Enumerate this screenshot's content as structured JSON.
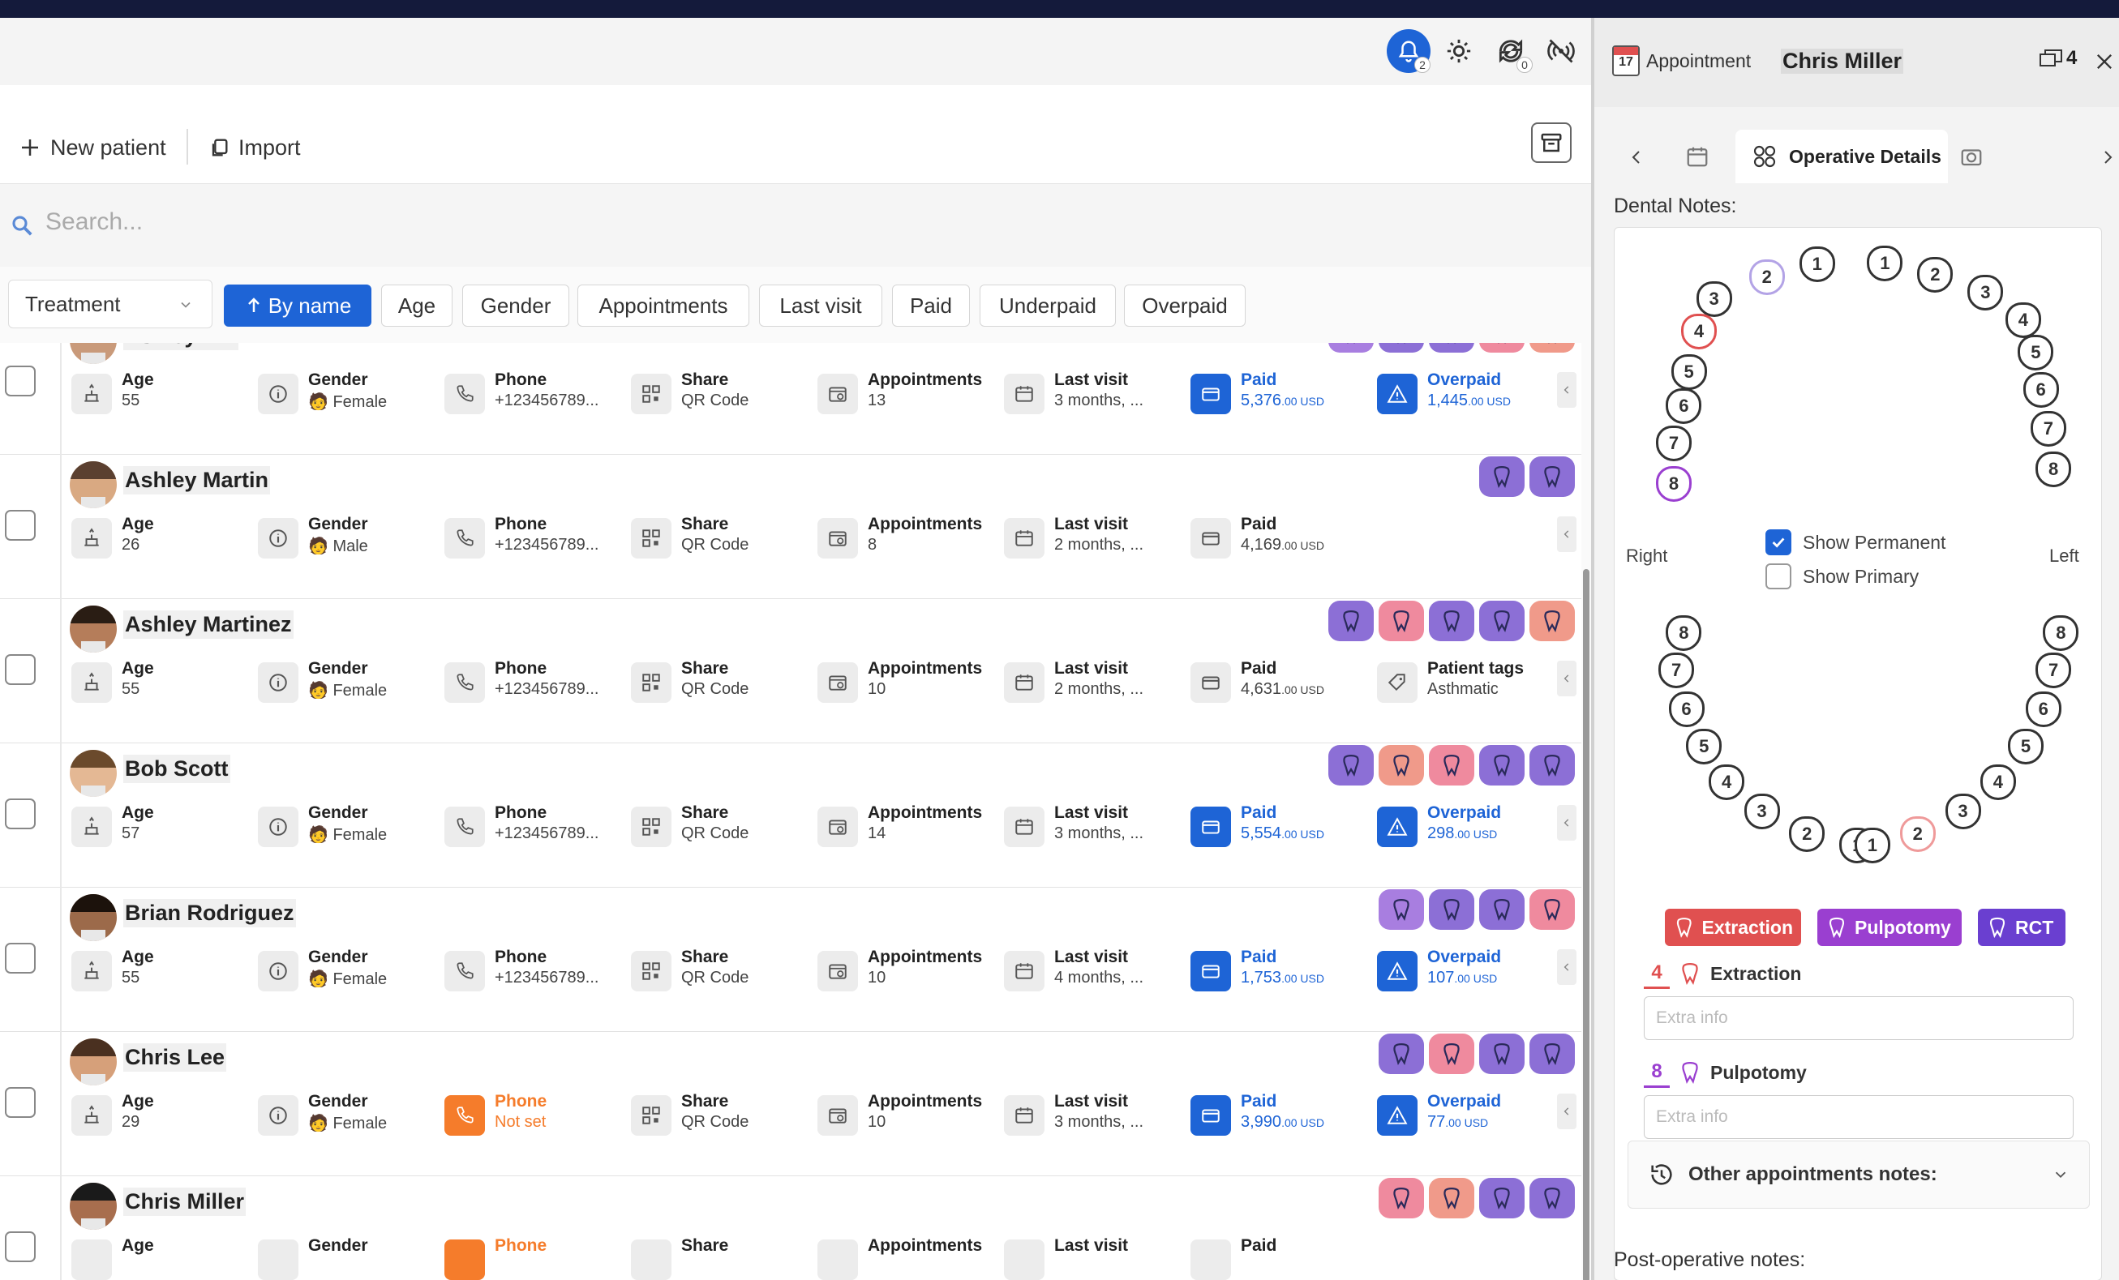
{
  "topbar": {
    "notifications_badge": "2",
    "sync_badge": "0"
  },
  "toolbar": {
    "new_patient": "New patient",
    "import": "Import"
  },
  "search": {
    "placeholder": "Search..."
  },
  "filters": {
    "select_value": "Treatment",
    "chips": [
      "By name",
      "Age",
      "Gender",
      "Appointments",
      "Last visit",
      "Paid",
      "Underpaid",
      "Overpaid"
    ],
    "active_chip": "By name"
  },
  "patients": [
    {
      "name": "Ashley Hill",
      "age": "55",
      "gender": "Female",
      "phone": "+123456789...",
      "share": "QR Code",
      "appointments": "13",
      "last_visit": "3 months, ...",
      "paid_main": "5,376",
      "paid_small": ".00 USD",
      "extra_label": "Overpaid",
      "extra_main": "1,445",
      "extra_small": ".00 USD",
      "tags": [
        "purple",
        "violet",
        "violet",
        "pink",
        "salmon"
      ]
    },
    {
      "name": "Ashley Martin",
      "age": "26",
      "gender": "Male",
      "phone": "+123456789...",
      "share": "QR Code",
      "appointments": "8",
      "last_visit": "2 months, ...",
      "paid_main": "4,169",
      "paid_small": ".00 USD",
      "extra_label": "",
      "extra_main": "",
      "extra_small": "",
      "tags": [
        "violet",
        "violet"
      ]
    },
    {
      "name": "Ashley Martinez",
      "age": "55",
      "gender": "Female",
      "phone": "+123456789...",
      "share": "QR Code",
      "appointments": "10",
      "last_visit": "2 months, ...",
      "paid_main": "4,631",
      "paid_small": ".00 USD",
      "extra_label": "Patient tags",
      "extra_main": "Asthmatic",
      "extra_small": "",
      "tags": [
        "violet",
        "pink",
        "violet",
        "violet",
        "salmon"
      ]
    },
    {
      "name": "Bob Scott",
      "age": "57",
      "gender": "Female",
      "phone": "+123456789...",
      "share": "QR Code",
      "appointments": "14",
      "last_visit": "3 months, ...",
      "paid_main": "5,554",
      "paid_small": ".00 USD",
      "extra_label": "Overpaid",
      "extra_main": "298",
      "extra_small": ".00 USD",
      "tags": [
        "violet",
        "salmon",
        "pink",
        "violet",
        "violet"
      ]
    },
    {
      "name": "Brian Rodriguez",
      "age": "55",
      "gender": "Female",
      "phone": "+123456789...",
      "share": "QR Code",
      "appointments": "10",
      "last_visit": "4 months, ...",
      "paid_main": "1,753",
      "paid_small": ".00 USD",
      "extra_label": "Overpaid",
      "extra_main": "107",
      "extra_small": ".00 USD",
      "tags": [
        "purple",
        "violet",
        "violet",
        "pink"
      ]
    },
    {
      "name": "Chris Lee",
      "age": "29",
      "gender": "Female",
      "phone": "Not set",
      "share": "QR Code",
      "appointments": "10",
      "last_visit": "3 months, ...",
      "paid_main": "3,990",
      "paid_small": ".00 USD",
      "extra_label": "Overpaid",
      "extra_main": "77",
      "extra_small": ".00 USD",
      "tags": [
        "violet",
        "pink",
        "violet",
        "violet"
      ]
    },
    {
      "name": "Chris Miller",
      "age": "",
      "gender": "",
      "phone": "",
      "share": "",
      "appointments": "",
      "last_visit": "",
      "paid_main": "",
      "paid_small": "",
      "extra_label": "",
      "extra_main": "",
      "extra_small": "",
      "tags": [
        "pink",
        "salmon",
        "violet",
        "violet"
      ]
    }
  ],
  "labels": {
    "age": "Age",
    "gender": "Gender",
    "phone": "Phone",
    "share": "Share",
    "appointments": "Appointments",
    "last_visit": "Last visit",
    "paid": "Paid"
  },
  "panel": {
    "title": "Appointment",
    "calendar_day": "17",
    "patient_name": "Chris Miller",
    "window_count": "4",
    "active_tab": "Operative Details",
    "dental_notes_label": "Dental Notes:",
    "right_label": "Right",
    "left_label": "Left",
    "show_permanent": "Show Permanent",
    "show_primary": "Show Primary",
    "legend": [
      "Extraction",
      "Pulpotomy",
      "RCT"
    ],
    "notes": [
      {
        "tooth": "4",
        "label": "Extraction",
        "placeholder": "Extra info"
      },
      {
        "tooth": "8",
        "label": "Pulpotomy",
        "placeholder": "Extra info"
      }
    ],
    "other_notes": "Other appointments notes:",
    "post_op": "Post-operative notes:"
  },
  "teeth_upper_right": [
    "1",
    "2",
    "3",
    "4",
    "5",
    "6",
    "7",
    "8"
  ],
  "teeth_upper_left": [
    "1",
    "2",
    "3",
    "4",
    "5",
    "6",
    "7",
    "8"
  ],
  "teeth_lower_right": [
    "8",
    "7",
    "6",
    "5",
    "4",
    "3",
    "2",
    "1"
  ],
  "teeth_lower_left": [
    "8",
    "7",
    "6",
    "5",
    "4",
    "3",
    "2",
    "1"
  ],
  "colors": {
    "accent": "#1e64d6",
    "extraction": "#e05050",
    "pulpotomy": "#9a3fd0",
    "rct": "#6a3fd0",
    "orange": "#f57c2b"
  }
}
